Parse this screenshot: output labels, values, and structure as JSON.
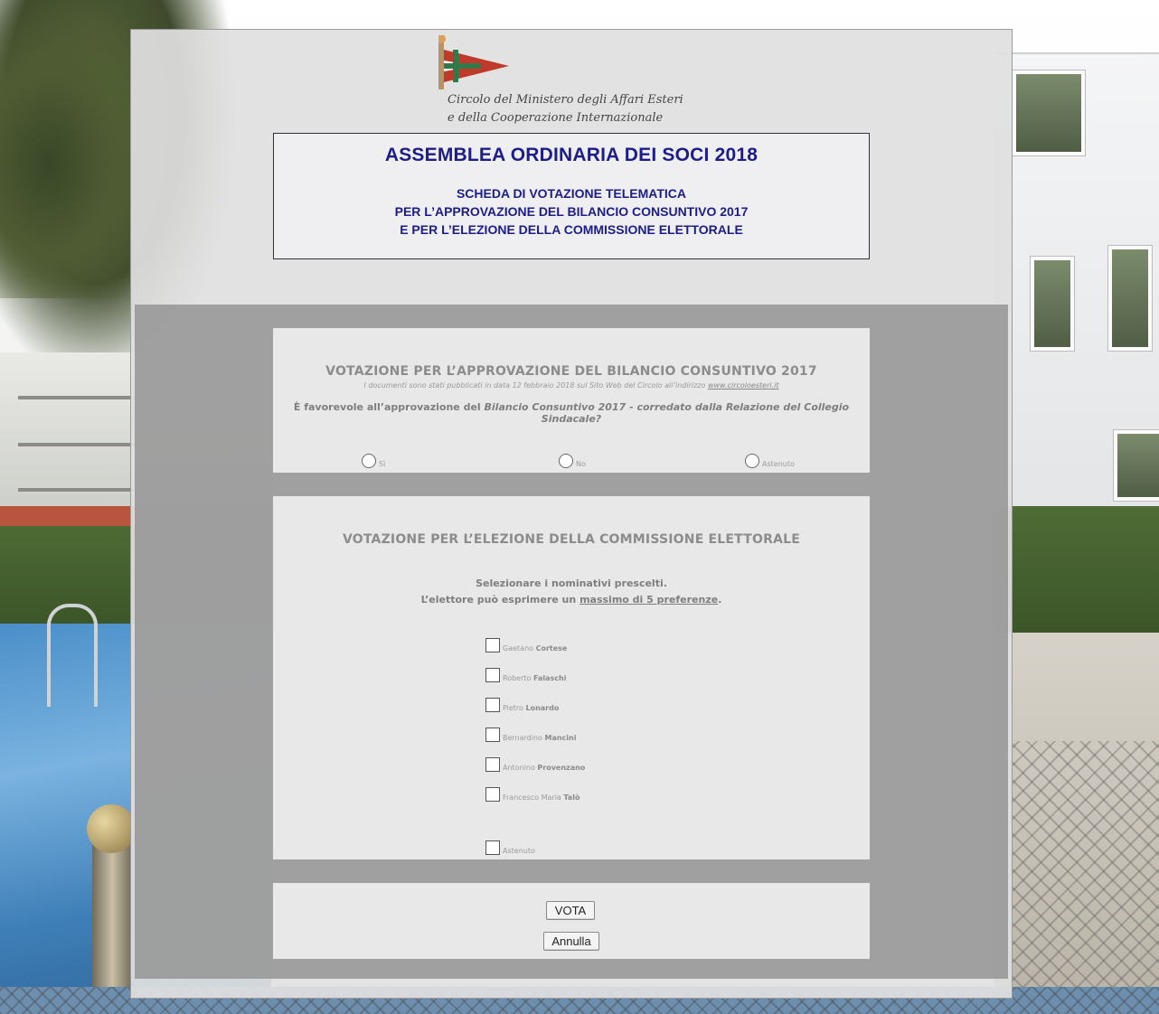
{
  "logo": {
    "line1": "Circolo del Ministero degli Affari Esteri",
    "line2": "e della Cooperazione Internazionale",
    "colors": {
      "flag_red": "#c03a2b",
      "flag_green": "#2f7a4a",
      "pole": "#b8936a"
    }
  },
  "header": {
    "title": "ASSEMBLEA ORDINARIA DEI SOCI 2018",
    "subtitle_lines": [
      "SCHEDA DI VOTAZIONE TELEMATICA",
      "PER L’APPROVAZIONE DEL BILANCIO CONSUNTIVO 2017",
      "E PER L’ELEZIONE DELLA COMMISSIONE ELETTORALE"
    ],
    "color": "#1c1c8a"
  },
  "bilancio": {
    "title": "VOTAZIONE PER L’APPROVAZIONE DEL BILANCIO CONSUNTIVO 2017",
    "note": "I documenti sono stati pubblicati in data 12 febbraio 2018 sul Sito Web del Circolo all’indirizzo",
    "link": "www.circoloesteri.it",
    "question_prefix": "È favorevole all’approvazione del",
    "question_italic": "Bilancio Consuntivo 2017 - corredato dalla Relazione del Collegio Sindacale?",
    "options": [
      "Sì",
      "No",
      "Astenuto"
    ]
  },
  "commissione": {
    "title": "VOTAZIONE PER L’ELEZIONE DELLA COMMISSIONE ELETTORALE",
    "instr_line1": "Selezionare i nominativi prescelti.",
    "instr_line2_prefix": "L’elettore può esprimere un",
    "instr_line2_underlined": "massimo di 5 preferenze",
    "instr_line2_suffix": ".",
    "candidates": [
      {
        "first": "Gaetano",
        "last": "Cortese"
      },
      {
        "first": "Roberto",
        "last": "Falaschi"
      },
      {
        "first": "Pietro",
        "last": "Lonardo"
      },
      {
        "first": "Bernardino",
        "last": "Mancini"
      },
      {
        "first": "Antonino",
        "last": "Provenzano"
      },
      {
        "first": "Francesco Maria",
        "last": "Talò"
      }
    ],
    "abstain": "Astenuto"
  },
  "actions": {
    "vota": "VOTA",
    "annulla": "Annulla"
  }
}
